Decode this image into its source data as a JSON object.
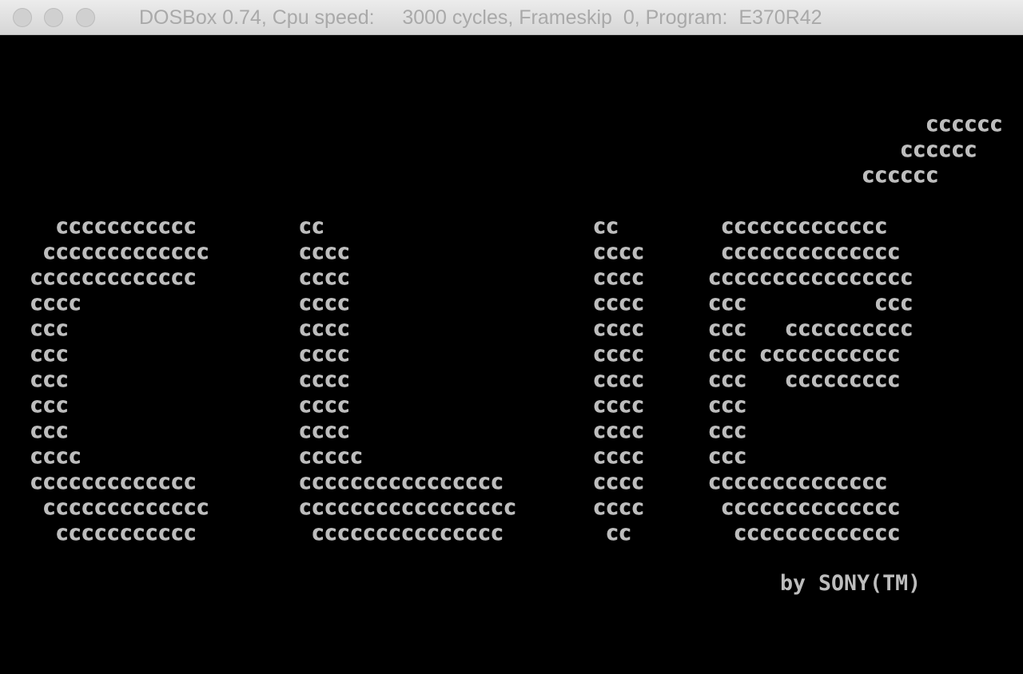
{
  "window": {
    "title": "DOSBox 0.74, Cpu speed:     3000 cycles, Frameskip  0, Program:  E370R42"
  },
  "screen": {
    "art_lines": [
      "                                                                          cccccc",
      "                                                                        cccccc",
      "                                                                     cccccc",
      "",
      "      ccccccccccc        cc                     cc        ccccccccccccc",
      "     ccccccccccccc       cccc                   cccc      cccccccccccccc",
      "    ccccccccccccc        cccc                   cccc     cccccccccccccccc",
      "    cccc                 cccc                   cccc     ccc          ccc",
      "    ccc                  cccc                   cccc     ccc   cccccccccc",
      "    ccc                  cccc                   cccc     ccc ccccccccccc",
      "    ccc                  cccc                   cccc     ccc   ccccccccc",
      "    ccc                  cccc                   cccc     ccc",
      "    ccc                  cccc                   cccc     ccc",
      "    cccc                 ccccc                  cccc     ccc",
      "    ccccccccccccc        cccccccccccccccc       cccc     cccccccccccccc",
      "     ccccccccccccc       ccccccccccccccccc      cccc      cccccccccccccc",
      "      ccccccccccc         ccccccccccccccc        cc        ccccccccccccc"
    ],
    "credit": "by SONY(TM)"
  },
  "colors": {
    "screen_bg": "#000000",
    "text": "#bdbdbd",
    "titlebar": "#e4e4e4",
    "title_text": "#a9a9a9"
  }
}
